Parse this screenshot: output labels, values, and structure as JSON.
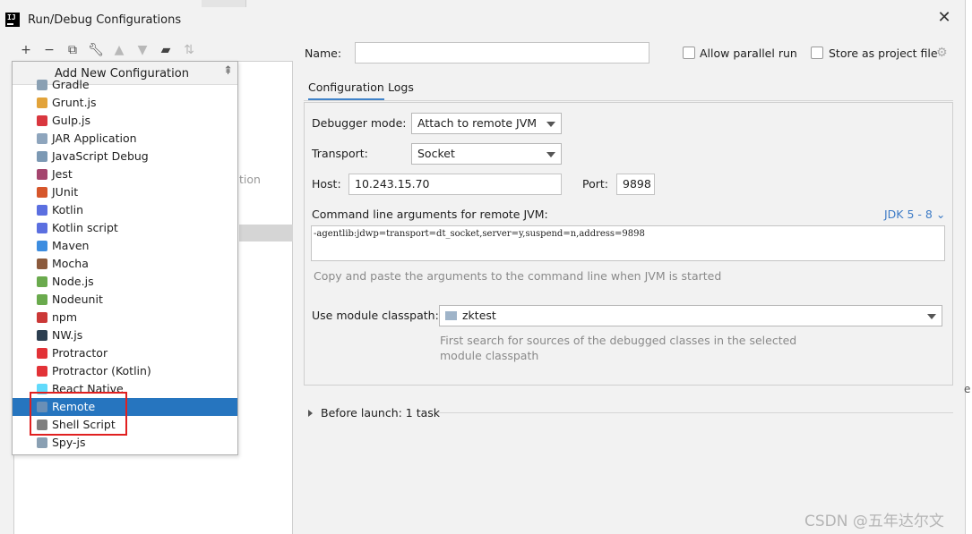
{
  "window": {
    "title": "Run/Debug Configurations",
    "app_icon": "IJ"
  },
  "toolbar": {
    "icons": [
      "add-icon",
      "remove-icon",
      "copy-icon",
      "wrench-icon",
      "move-up-icon",
      "move-down-icon",
      "folder-add-icon",
      "sort-icon"
    ]
  },
  "left_pane": {
    "ghost_text": "tion"
  },
  "popup": {
    "title": "Add New Configuration",
    "items": [
      {
        "label": "Gradle",
        "icon": "gradle-icon",
        "color": "#8aa0b3"
      },
      {
        "label": "Grunt.js",
        "icon": "grunt-icon",
        "color": "#e2a33a"
      },
      {
        "label": "Gulp.js",
        "icon": "gulp-icon",
        "color": "#d9373f"
      },
      {
        "label": "JAR Application",
        "icon": "jar-icon",
        "color": "#8ea5bd"
      },
      {
        "label": "JavaScript Debug",
        "icon": "js-debug-icon",
        "color": "#7c99b4"
      },
      {
        "label": "Jest",
        "icon": "jest-icon",
        "color": "#a5456e"
      },
      {
        "label": "JUnit",
        "icon": "junit-icon",
        "color": "#d6562b"
      },
      {
        "label": "Kotlin",
        "icon": "kotlin-icon",
        "color": "#5b6fe0"
      },
      {
        "label": "Kotlin script",
        "icon": "kotlin-script-icon",
        "color": "#5b6fe0"
      },
      {
        "label": "Maven",
        "icon": "maven-icon",
        "color": "#3d8de0"
      },
      {
        "label": "Mocha",
        "icon": "mocha-icon",
        "color": "#8b5a3c"
      },
      {
        "label": "Node.js",
        "icon": "nodejs-icon",
        "color": "#6aaa4d"
      },
      {
        "label": "Nodeunit",
        "icon": "nodeunit-icon",
        "color": "#6aaa4d"
      },
      {
        "label": "npm",
        "icon": "npm-icon",
        "color": "#cb3837"
      },
      {
        "label": "NW.js",
        "icon": "nwjs-icon",
        "color": "#2c3e50"
      },
      {
        "label": "Protractor",
        "icon": "protractor-icon",
        "color": "#e23237"
      },
      {
        "label": "Protractor (Kotlin)",
        "icon": "protractor-kotlin-icon",
        "color": "#e23237"
      },
      {
        "label": "React Native",
        "icon": "react-native-icon",
        "color": "#61dafb"
      },
      {
        "label": "Remote",
        "icon": "remote-icon",
        "color": "#6a8fb6",
        "selected": true
      },
      {
        "label": "Shell Script",
        "icon": "shell-script-icon",
        "color": "#7f7f7f"
      },
      {
        "label": "Spy-js",
        "icon": "spyjs-icon",
        "color": "#8aa0b3"
      }
    ]
  },
  "form": {
    "name_label": "Name:",
    "name_value": "",
    "allow_parallel_label": "Allow parallel run",
    "store_project_label": "Store as project file",
    "tabs": [
      "Configuration",
      "Logs"
    ],
    "debugger_mode_label": "Debugger mode:",
    "debugger_mode_value": "Attach to remote JVM",
    "transport_label": "Transport:",
    "transport_value": "Socket",
    "host_label": "Host:",
    "host_value": "10.243.15.70",
    "port_label": "Port:",
    "port_value": "9898",
    "cmd_label": "Command line arguments for remote JVM:",
    "jdk_link": "JDK 5 - 8",
    "cmd_value": "-agentlib:jdwp=transport=dt_socket,server=y,suspend=n,address=9898",
    "cmd_hint": "Copy and paste the arguments to the command line when JVM is started",
    "module_label": "Use module classpath:",
    "module_value": "zktest",
    "module_hint_1": "First search for sources of the debugged classes in the selected",
    "module_hint_2": "module classpath",
    "before_launch": "Before launch: 1 task"
  },
  "watermark": "CSDN @五年达尔文",
  "edge_char": "e"
}
